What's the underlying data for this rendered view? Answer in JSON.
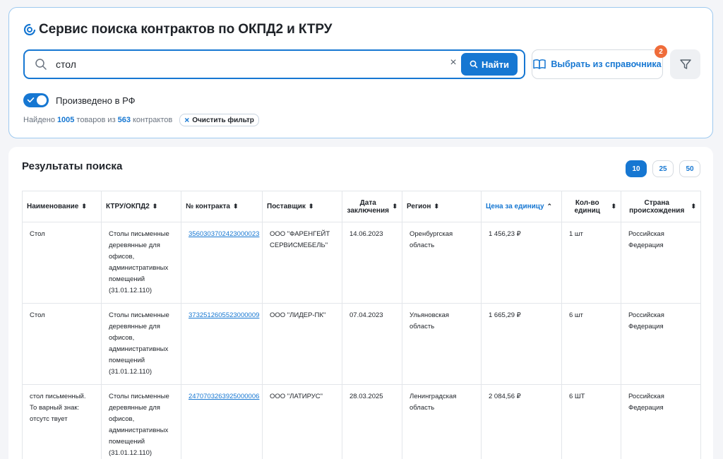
{
  "header": {
    "title": "Сервис поиска контрактов по ОКПД2 и КТРУ"
  },
  "search": {
    "value": "стол",
    "find_label": "Найти",
    "reference_label": "Выбрать из справочника",
    "reference_badge": "2"
  },
  "filters": {
    "made_in_rf_label": "Произведено в РФ",
    "made_in_rf_on": true,
    "found_prefix": "Найдено",
    "found_goods": "1005",
    "found_middle": "товаров из",
    "found_contracts": "563",
    "found_suffix": "контрактов",
    "clear_filter_label": "Очистить фильтр"
  },
  "results": {
    "title": "Результаты поиска",
    "page_sizes": [
      "10",
      "25",
      "50"
    ],
    "active_page_size": "10",
    "columns": [
      "Наименование",
      "КТРУ/ОКПД2",
      "№ контракта",
      "Поставщик",
      "Дата заключения",
      "Регион",
      "Цена за единицу",
      "Кол-во единиц",
      "Страна происхождения"
    ],
    "rows": [
      {
        "name": "Стол",
        "ktru": "Столы письменные деревянные для офисов, административных помещений (31.01.12.110)",
        "contract": "3560303702423000023",
        "supplier": "ООО \"ФАРЕНГЕЙТ СЕРВИСМЕБЕЛЬ\"",
        "date": "14.06.2023",
        "region": "Оренбургская область",
        "price": "1 456,23 ₽",
        "qty": "1 шт",
        "country": "Российская Федерация"
      },
      {
        "name": "Стол",
        "ktru": "Столы письменные деревянные для офисов, административных помещений (31.01.12.110)",
        "contract": "3732512605523000009",
        "supplier": "ООО \"ЛИДЕР-ПК\"",
        "date": "07.04.2023",
        "region": "Ульяновская область",
        "price": "1 665,29 ₽",
        "qty": "6 шт",
        "country": "Российская Федерация"
      },
      {
        "name": "стол письменный. То варный знак: отсутс твует",
        "ktru": "Столы письменные деревянные для офисов, административных помещений (31.01.12.110)",
        "contract": "2470703263925000006",
        "supplier": "ООО \"ЛАТИРУС\"",
        "date": "28.03.2025",
        "region": "Ленинградская область",
        "price": "2 084,56 ₽",
        "qty": "6 ШТ",
        "country": "Российская Федерация"
      }
    ]
  },
  "colors": {
    "accent": "#1677d2",
    "badge": "#ef6c3a",
    "card_border": "#9ec9ef"
  },
  "icons": [
    "logo-icon",
    "search-icon",
    "clear-icon",
    "book-icon",
    "filter-icon",
    "check-icon",
    "close-icon",
    "sort-icon",
    "sort-asc-icon"
  ]
}
